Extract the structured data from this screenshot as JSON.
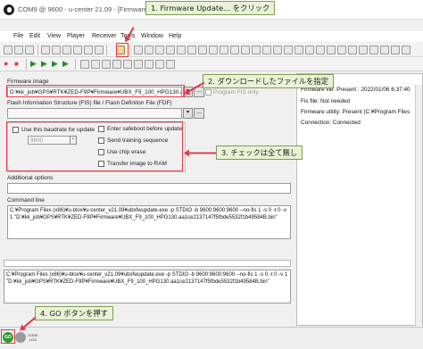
{
  "window": {
    "title": "COM9 @ 9600 - u-center 21.09 - [Firmware Update Utility]"
  },
  "menu": [
    "File",
    "Edit",
    "View",
    "Player",
    "Receiver",
    "Tools",
    "Window",
    "Help"
  ],
  "firmware": {
    "image_label": "Firmware image",
    "image_value": "D:¥kk_job¥GPS¥RTK¥ZED-F9P¥Firmware¥UBX_F9_100_HPG130.aa",
    "browse_label": "...",
    "use_fis_label": "Program FIS only",
    "fis_label": "Flash Information Structure (FIS) file / Flash Definiton File (FDF)",
    "fis_value": "",
    "baud_checkbox_label": "Use this baudrate for update",
    "baud_value": "9600",
    "options": [
      "Enter safeboot before update",
      "Send training sequence",
      "Use chip erase",
      "Transfer image to RAM"
    ],
    "additional_label": "Additional options",
    "additional_value": "",
    "command_label": "Command line",
    "command_text": "C:¥Program Files (x86)¥u-blox¥u-center_v21.09¥ubxfwupdate.exe -p STDIO -b 9600:9600:9600 --no-fis 1 -s 0 -t 0 -v 1 \"D:¥kk_job¥GPS¥RTK¥ZED-F9P¥Firmware¥UBX_F9_100_HPG130.aa1ce2137147f5fbde5532f1b49584B.bin\"",
    "log_text": "C:¥Program Files (x86)¥u-blox¥u-center_v21.09¥ubxfwupdate.exe -p STDIO -b 9600:9600:9600 --no-fis 1 -s 0 -t 0 -v 1 \"D:¥kk_job¥GPS¥RTK¥ZED-F9P¥Firmware¥UBX_F9_100_HPG130.aa1ce2137147f5fbde5532f1b49584B.bin\""
  },
  "info": {
    "lines": [
      "Firmware file: Present : 2022/01/06 6:37:40",
      "Fis file: Not needed",
      "Firmware utility: Present (C:¥Program Files",
      "Connection: Connected"
    ]
  },
  "statusbar": {
    "go_label": "GO",
    "other_label": "CODE LOG"
  },
  "annotations": {
    "a1": "1. Firmware Update... をクリック",
    "a2": "2. ダウンロードしたファイルを指定",
    "a3": "3. チェックは全て無し",
    "a4": "4. GO ボタンを押す"
  },
  "colors": {
    "annotation_bg": "#e8f2d5",
    "annotation_border": "#7e9d52",
    "highlight_red": "#e03b4a",
    "go_green": "#2e9a2e"
  }
}
